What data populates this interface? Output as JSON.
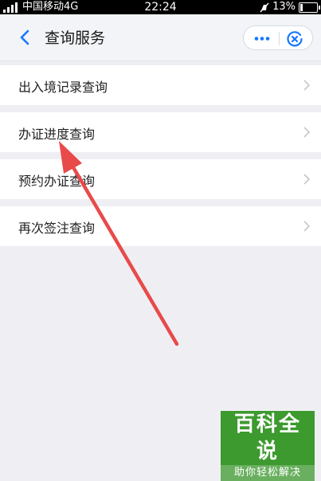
{
  "status_bar": {
    "carrier": "中国移动4G",
    "time": "22:24",
    "battery": "13%",
    "battery_level": 0.13
  },
  "nav": {
    "title": "查询服务",
    "icons": {
      "back": "back-icon",
      "more": "more-icon",
      "close": "close-mini-icon"
    }
  },
  "menu": {
    "items": [
      {
        "label": "出入境记录查询"
      },
      {
        "label": "办证进度查询"
      },
      {
        "label": "预约办证查询"
      },
      {
        "label": "再次签注查询"
      }
    ]
  },
  "colors": {
    "accent": "#1677ff",
    "arrow": "#e84a4a",
    "background": "#efeff3"
  },
  "watermark": {
    "title": "百科全说",
    "subtitle": "助你轻松解决"
  }
}
